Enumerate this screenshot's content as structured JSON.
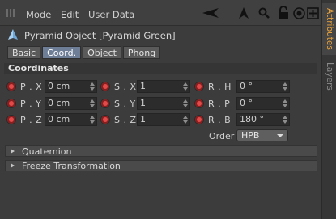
{
  "menu": {
    "items": [
      "Mode",
      "Edit",
      "User Data"
    ]
  },
  "toolbar": {
    "icons": [
      "back-arrow-icon",
      "up-arrow-icon",
      "search-icon",
      "lock-icon",
      "target-icon",
      "new-panel-icon"
    ]
  },
  "object": {
    "title": "Pyramid Object [Pyramid Green]",
    "icon": "pyramid-icon"
  },
  "tabs": [
    {
      "label": "Basic",
      "active": false
    },
    {
      "label": "Coord.",
      "active": true
    },
    {
      "label": "Object",
      "active": false
    },
    {
      "label": "Phong",
      "active": false
    }
  ],
  "section": {
    "title": "Coordinates"
  },
  "coordinates": {
    "position": [
      {
        "label": "P . X",
        "value": "0 cm"
      },
      {
        "label": "P . Y",
        "value": "0 cm"
      },
      {
        "label": "P . Z",
        "value": "0 cm"
      }
    ],
    "scale": [
      {
        "label": "S . X",
        "value": "1"
      },
      {
        "label": "S . Y",
        "value": "1"
      },
      {
        "label": "S . Z",
        "value": "1"
      }
    ],
    "rotation": [
      {
        "label": "R . H",
        "value": "0 °"
      },
      {
        "label": "R . P",
        "value": "0 °"
      },
      {
        "label": "R . B",
        "value": "180 °"
      }
    ]
  },
  "order": {
    "label": "Order",
    "value": "HPB"
  },
  "groups": [
    {
      "label": "Quaternion"
    },
    {
      "label": "Freeze Transformation"
    }
  ],
  "side_tabs": [
    {
      "label": "Attributes",
      "active": true
    },
    {
      "label": "Layers",
      "active": false
    }
  ],
  "colors": {
    "accent_tab": "#e8a13b",
    "radio_red": "#e24a4a",
    "active_tab": "#6e7e96"
  }
}
